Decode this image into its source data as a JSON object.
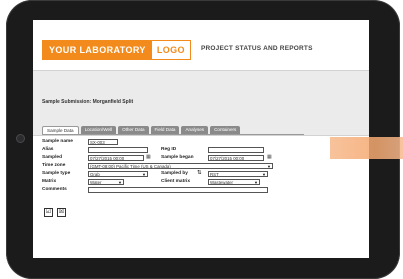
{
  "header": {
    "brand_text": "YOUR LABORATORY",
    "logo_text": "LOGO",
    "title": "PROJECT STATUS AND REPORTS"
  },
  "submission_title": "Sample Submission: Morganfield Split",
  "tabs": [
    {
      "label": "Sample Data",
      "active": true
    },
    {
      "label": "Location/Well",
      "active": false
    },
    {
      "label": "Other Data",
      "active": false
    },
    {
      "label": "Field Data",
      "active": false
    },
    {
      "label": "Analyses",
      "active": false
    },
    {
      "label": "Containers",
      "active": false
    }
  ],
  "form": {
    "sample_name_label": "Sample name",
    "sample_name_value": "SX-003",
    "alias_label": "Alias",
    "alias_value": "",
    "reg_id_label": "Reg ID",
    "reg_id_value": "",
    "sampled_label": "Sampled",
    "sampled_value": "07/27/2015 00:00",
    "sample_began_label": "Sample began",
    "sample_began_value": "07/27/2015 00:00",
    "time_zone_label": "Time zone",
    "time_zone_value": "(GMT-08:00) Pacific Time (US & Canada)",
    "sample_type_label": "Sample type",
    "sample_type_value": "Grab",
    "sampled_by_label": "Sampled by",
    "sampled_by_value": "RST",
    "matrix_label": "Matrix",
    "matrix_value": "Water",
    "client_matrix_label": "Client matrix",
    "client_matrix_value": "Wastewater",
    "comments_label": "Comments",
    "comments_value": ""
  },
  "actions": {
    "confirm_glyph": "☑",
    "cancel_glyph": "☒"
  },
  "colors": {
    "brand_orange": "#f28a1c",
    "tablet_frame": "#1b1b1c",
    "tab_inactive": "#8a8a8a"
  }
}
